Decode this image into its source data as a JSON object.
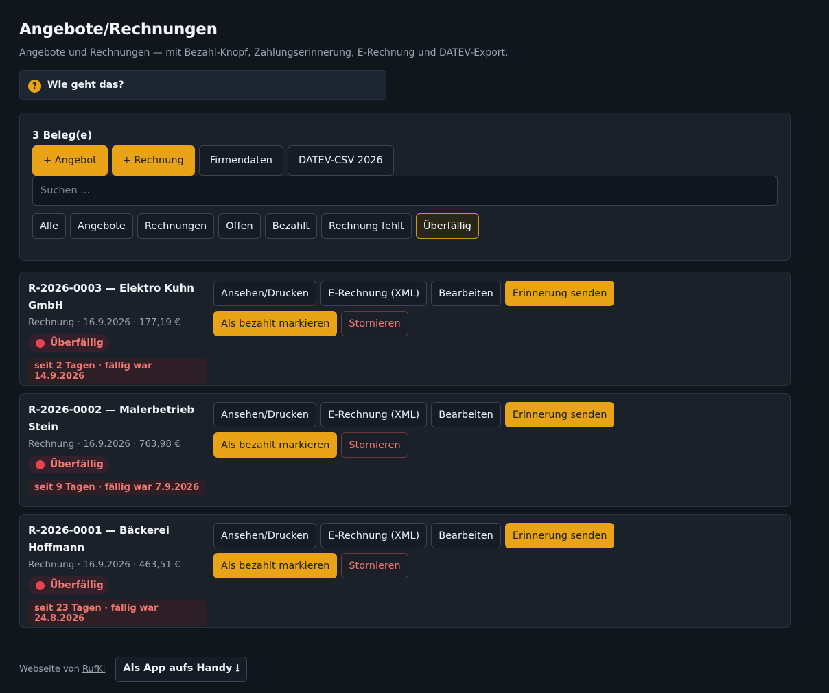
{
  "page": {
    "title": "Angebote/Rechnungen",
    "subtitle": "Angebote und Rechnungen — mit Bezahl-Knopf, Zahlungserinnerung, E-Rechnung und DATEV-Export."
  },
  "help": {
    "icon": "question-icon",
    "icon_glyph": "?",
    "label": "Wie geht das?"
  },
  "panel": {
    "count_label": "3 Beleg(e)",
    "toolbar": {
      "new_offer": "+ Angebot",
      "new_invoice": "+ Rechnung",
      "company_data": "Firmendaten",
      "datev_export": "DATEV-CSV 2026"
    },
    "search": {
      "placeholder": "Suchen ...",
      "value": ""
    },
    "filters": [
      "Alle",
      "Angebote",
      "Rechnungen",
      "Offen",
      "Bezahlt",
      "Rechnung fehlt",
      "Überfällig"
    ],
    "active_filter": "Überfällig"
  },
  "actions": {
    "view_print": "Ansehen/Drucken",
    "e_invoice": "E-Rechnung (XML)",
    "edit": "Bearbeiten",
    "send_reminder": "Erinnerung senden",
    "mark_paid": "Als bezahlt markieren",
    "cancel": "Stornieren"
  },
  "invoices": [
    {
      "title": "R-2026-0003 — Elektro Kuhn GmbH",
      "meta": "Rechnung · 16.9.2026 · 177,19 €",
      "status": "Überfällig",
      "overdue_note": "seit 2 Tagen · fällig war 14.9.2026"
    },
    {
      "title": "R-2026-0002 — Malerbetrieb Stein",
      "meta": "Rechnung · 16.9.2026 · 763,98 €",
      "status": "Überfällig",
      "overdue_note": "seit 9 Tagen · fällig war 7.9.2026"
    },
    {
      "title": "R-2026-0001 — Bäckerei Hoffmann",
      "meta": "Rechnung · 16.9.2026 · 463,51 €",
      "status": "Überfällig",
      "overdue_note": "seit 23 Tagen · fällig war 24.8.2026"
    }
  ],
  "footer": {
    "text": "Webseite von",
    "link": "RufKi",
    "install_button": "Als App aufs Handy ⭳"
  },
  "colors": {
    "background": "#11151c",
    "panel": "#1a212b",
    "accent": "#e8a317",
    "danger": "#f07872"
  }
}
